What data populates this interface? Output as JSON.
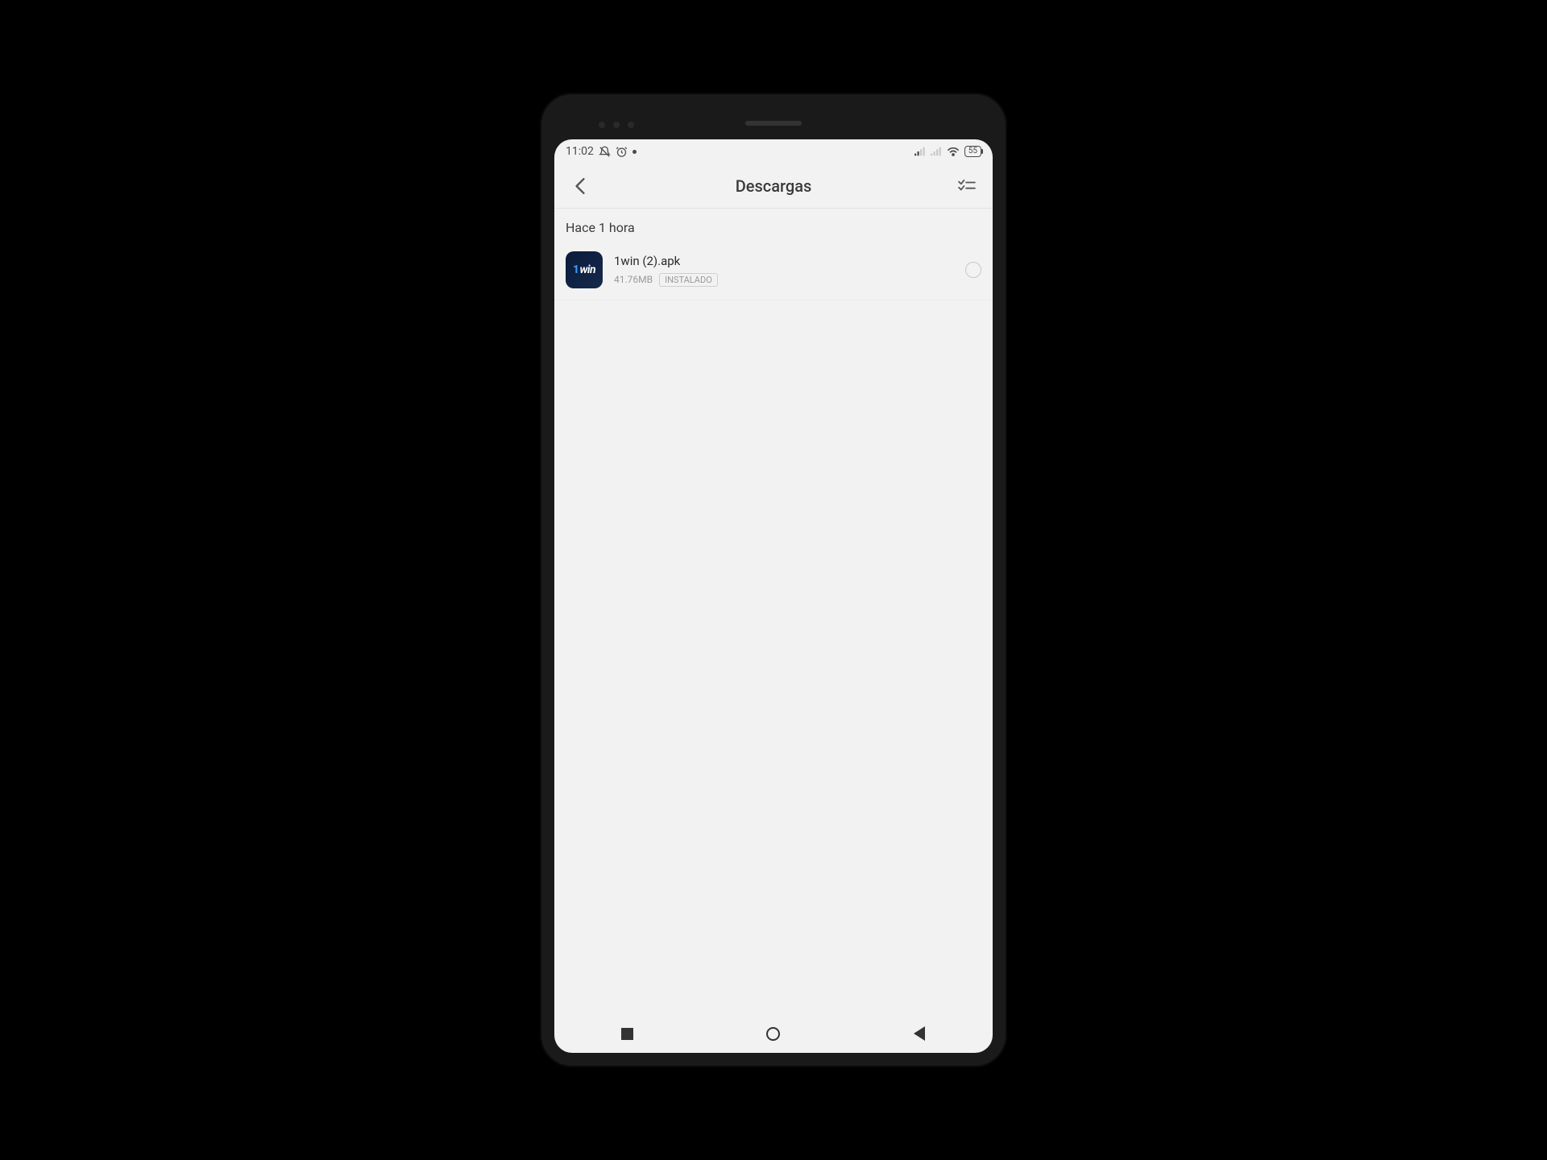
{
  "status_bar": {
    "time": "11:02",
    "battery": "55"
  },
  "header": {
    "title": "Descargas"
  },
  "section": {
    "label": "Hace 1 hora"
  },
  "downloads": [
    {
      "icon_text_prefix": "1",
      "icon_text": "win",
      "filename": "1win (2).apk",
      "size": "41.76MB",
      "status": "INSTALADO"
    }
  ]
}
